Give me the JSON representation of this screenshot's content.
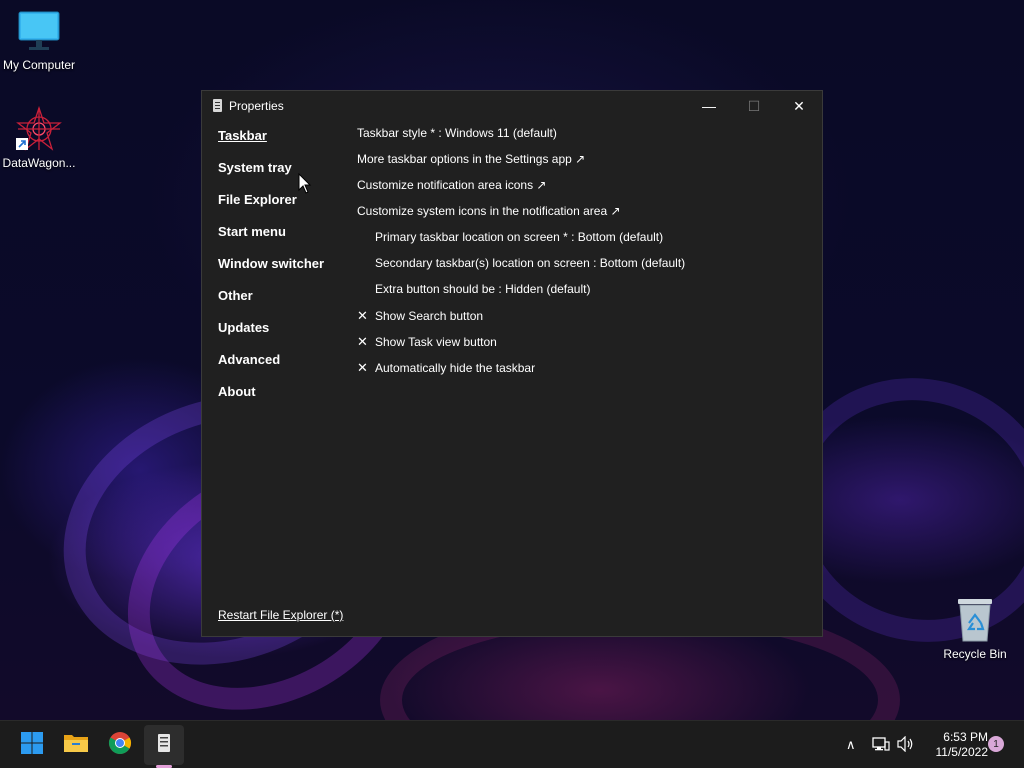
{
  "desktop": {
    "icons": [
      {
        "label": "My Computer",
        "icon": "monitor-icon"
      },
      {
        "label": "DataWagon...",
        "icon": "datawagon-shortcut-icon"
      },
      {
        "label": "Recycle Bin",
        "icon": "recycle-bin-icon"
      }
    ]
  },
  "window": {
    "title": "Properties",
    "controls": {
      "minimize": "—",
      "maximize": "☐",
      "close": "✕"
    },
    "nav": [
      {
        "label": "Taskbar",
        "active": true
      },
      {
        "label": "System tray"
      },
      {
        "label": "File Explorer"
      },
      {
        "label": "Start menu"
      },
      {
        "label": "Window switcher"
      },
      {
        "label": "Other"
      },
      {
        "label": "Updates"
      },
      {
        "label": "Advanced"
      },
      {
        "label": "About"
      }
    ],
    "options": [
      "Taskbar style * : Windows 11 (default)",
      "More taskbar options in the Settings app ↗",
      "Customize notification area icons ↗",
      "Customize system icons in the notification area ↗",
      "Primary taskbar location on screen * : Bottom (default)",
      "Secondary taskbar(s) location on screen : Bottom (default)",
      "Extra button should be : Hidden (default)"
    ],
    "checkboxes": [
      {
        "mark": "✕",
        "label": "Show Search button"
      },
      {
        "mark": "✕",
        "label": "Show Task view button"
      },
      {
        "mark": "✕",
        "label": "Automatically hide the taskbar"
      }
    ],
    "restart_link": "Restart File Explorer (*)"
  },
  "taskbar": {
    "apps": [
      "start-icon",
      "file-explorer-icon",
      "chrome-icon",
      "properties-app-icon"
    ],
    "tray": {
      "chevron": "∧",
      "time": "6:53 PM",
      "date": "11/5/2022",
      "notification_count": "1"
    }
  },
  "colors": {
    "window_bg": "#202020",
    "taskbar_bg": "#1c1c1c",
    "accent": "#e3a0d8"
  }
}
